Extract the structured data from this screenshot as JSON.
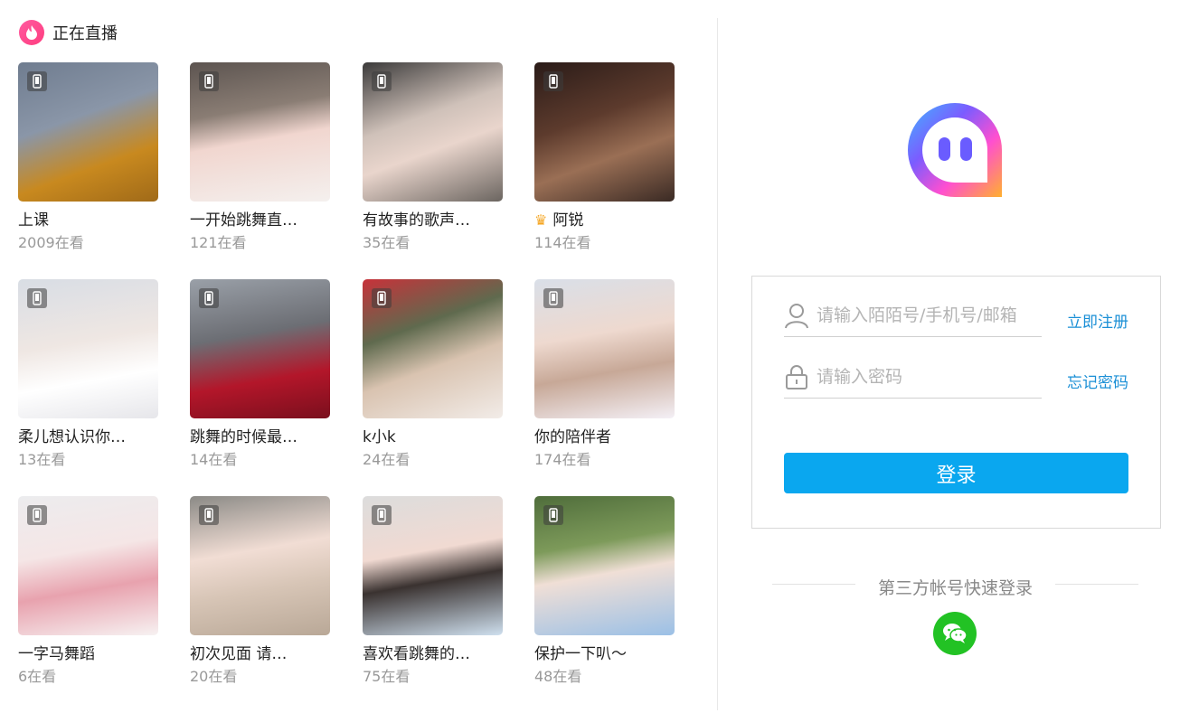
{
  "live": {
    "title": "正在直播",
    "cards": [
      {
        "name": "上课",
        "viewers": "2009在看",
        "crown": false,
        "bg": "linear-gradient(160deg,#6f7c8f 0%,#8a96a8 40%,#c8891f 70%,#a06a18 100%)"
      },
      {
        "name": "一开始跳舞直…",
        "viewers": "121在看",
        "crown": false,
        "bg": "linear-gradient(170deg,#5c5450 0%,#8a7d74 35%,#f1d6cf 55%,#f4f0ee 100%)"
      },
      {
        "name": "有故事的歌声…",
        "viewers": "35在看",
        "crown": false,
        "bg": "linear-gradient(160deg,#3b3a3a 0%,#cfc1b9 40%,#e9d5cc 60%,#6b6560 100%)"
      },
      {
        "name": "阿锐",
        "viewers": "114在看",
        "crown": true,
        "bg": "linear-gradient(160deg,#2a1b18 0%,#5d3b2d 40%,#9a6f55 65%,#3a2a24 100%)"
      },
      {
        "name": "柔儿想认识你…",
        "viewers": "13在看",
        "crown": false,
        "bg": "linear-gradient(170deg,#d8dde4 0%,#efe7e3 45%,#ffffff 70%,#e6e6ea 100%)"
      },
      {
        "name": "跳舞的时候最…",
        "viewers": "14在看",
        "crown": false,
        "bg": "linear-gradient(170deg,#9aa0a8 0%,#6c6e74 40%,#b3162a 70%,#7a0f1d 100%)"
      },
      {
        "name": "k小k",
        "viewers": "24在看",
        "crown": false,
        "bg": "linear-gradient(160deg,#c7323a 0%,#5f6a4e 35%,#d9c3b0 60%,#f2ece8 100%)"
      },
      {
        "name": "你的陪伴者",
        "viewers": "174在看",
        "crown": false,
        "bg": "linear-gradient(170deg,#d9dfe8 0%,#eed9cf 40%,#c7a897 65%,#f4f0f6 100%)"
      },
      {
        "name": "一字马舞蹈",
        "viewers": "6在看",
        "crown": false,
        "bg": "linear-gradient(170deg,#ececee 0%,#f5e6e6 40%,#e8a2ae 65%,#f7f2f2 100%)"
      },
      {
        "name": "初次见面 请…",
        "viewers": "20在看",
        "crown": false,
        "bg": "linear-gradient(170deg,#8b8a86 0%,#f1ddd4 40%,#d7c5b6 65%,#b9a897 100%)"
      },
      {
        "name": "喜欢看跳舞的…",
        "viewers": "75在看",
        "crown": false,
        "bg": "linear-gradient(170deg,#dcdcdc 0%,#f1dad2 40%,#3a3230 60%,#cfe0ef 100%)"
      },
      {
        "name": "保护一下叭～",
        "viewers": "48在看",
        "crown": false,
        "bg": "linear-gradient(170deg,#4f6d3b 0%,#7d9a5a 35%,#f0dfd6 55%,#9bc0e6 100%)"
      }
    ]
  },
  "login": {
    "account_placeholder": "请输入陌陌号/手机号/邮箱",
    "password_placeholder": "请输入密码",
    "register_link": "立即注册",
    "forgot_link": "忘记密码",
    "submit_label": "登录"
  },
  "third_party": {
    "title": "第三方帐号快速登录"
  },
  "colors": {
    "accent": "#0aa7ef",
    "link": "#1a8fd6",
    "wechat": "#22c224"
  }
}
